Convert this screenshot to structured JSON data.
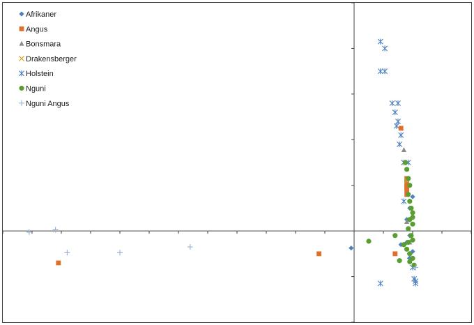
{
  "chart_data": {
    "type": "scatter",
    "title": "",
    "xlabel": "",
    "ylabel": "",
    "xlim": [
      -12,
      4
    ],
    "ylim": [
      -4,
      10
    ],
    "grid": false,
    "legend_position": "top-left",
    "colors": {
      "Afrikaner": "#4f81bd",
      "Angus": "#e06f2c",
      "Bonsmara": "#8c8c8c",
      "Drakensberger": "#d9a21c",
      "Holstein": "#4f81bd",
      "Nguni": "#5a9e32",
      "Nguni Angus": "#9db3d6"
    },
    "series": [
      {
        "name": "Afrikaner",
        "marker": "diamond",
        "x": [
          -0.1,
          1.6,
          1.8,
          1.9,
          2.0,
          1.8,
          1.9,
          2.0,
          1.9
        ],
        "y": [
          -0.75,
          -0.6,
          -0.5,
          -0.2,
          -0.9,
          0.5,
          1.0,
          1.5,
          -1.2
        ]
      },
      {
        "name": "Angus",
        "marker": "square",
        "x": [
          -10.1,
          -1.2,
          1.4,
          1.6,
          1.8,
          1.8,
          1.8,
          1.8,
          1.8,
          1.8,
          1.8
        ],
        "y": [
          -1.4,
          -1.0,
          -1.0,
          4.5,
          1.6,
          1.8,
          1.9,
          2.0,
          2.1,
          2.2,
          2.3
        ]
      },
      {
        "name": "Bonsmara",
        "marker": "triangle",
        "x": [
          1.7,
          1.8,
          1.9,
          1.8
        ],
        "y": [
          3.55,
          2.25,
          -0.5,
          0.4
        ]
      },
      {
        "name": "Drakensberger",
        "marker": "x",
        "x": [
          1.7,
          1.8
        ],
        "y": [
          3.0,
          2.2
        ]
      },
      {
        "name": "Holstein",
        "marker": "asterisk",
        "x": [
          0.9,
          1.05,
          0.9,
          1.05,
          1.3,
          1.5,
          1.4,
          1.5,
          1.45,
          1.6,
          1.55,
          1.7,
          1.85,
          1.7,
          1.9,
          2.0,
          2.05,
          2.1,
          0.9,
          2.1
        ],
        "y": [
          8.3,
          8.0,
          7.0,
          7.0,
          5.6,
          5.6,
          5.2,
          4.8,
          4.6,
          4.2,
          3.8,
          3.0,
          3.0,
          1.3,
          -1.1,
          -1.6,
          -2.1,
          -2.3,
          -2.3,
          -2.2
        ],
        "x_note": ""
      },
      {
        "name": "Nguni",
        "marker": "circle",
        "x": [
          0.5,
          1.4,
          1.75,
          1.8,
          1.85,
          1.9,
          1.85,
          1.9,
          1.95,
          2.0,
          1.9,
          2.0,
          1.85,
          1.95,
          2.0,
          1.85,
          1.7,
          1.8,
          1.9,
          2.0,
          1.9,
          2.05,
          1.55,
          2.0
        ],
        "y": [
          -0.45,
          -0.2,
          3.0,
          2.7,
          2.3,
          2.0,
          1.6,
          1.3,
          1.0,
          0.8,
          0.5,
          0.3,
          0.1,
          -0.2,
          -0.4,
          -0.5,
          -0.6,
          -0.8,
          -1.0,
          -1.2,
          -1.35,
          -1.5,
          -1.3,
          0.6
        ]
      },
      {
        "name": "Nguni Angus",
        "marker": "plus",
        "x": [
          -11.1,
          -10.2,
          -9.8,
          -8.0,
          -5.6,
          2.1
        ],
        "y": [
          -0.05,
          0.05,
          -0.95,
          -0.95,
          -0.7,
          -1.6
        ]
      }
    ]
  }
}
